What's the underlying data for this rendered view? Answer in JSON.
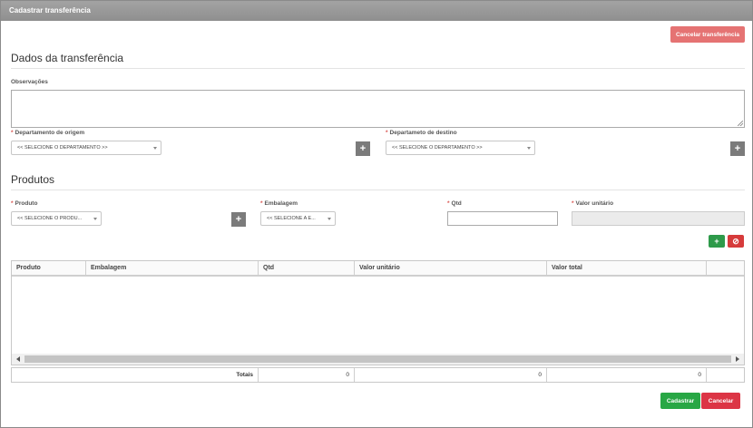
{
  "window": {
    "title": "Cadastrar transferência"
  },
  "actions": {
    "cancel_transfer": "Cancelar transferência"
  },
  "transfer": {
    "section_title": "Dados da transferência",
    "notes_label": "Observações",
    "notes_value": "",
    "origin_label": "Departamento de origem",
    "origin_value": "<< SELECIONE O DEPARTAMENTO >>",
    "destination_label": "Departameto de destino",
    "destination_value": "<< SELECIONE O DEPARTAMENTO >>",
    "required_marker": "*"
  },
  "products": {
    "section_title": "Produtos",
    "product_label": "Produto",
    "product_value": "<< SELECIONE O PRODU...",
    "packaging_label": "Embalagem",
    "packaging_value": "<< SELECIONE A E...",
    "qty_label": "Qtd",
    "qty_value": "",
    "unit_value_label": "Valor unitário",
    "unit_value_value": "",
    "add_icon": "plus-icon",
    "remove_icon": "ban-icon"
  },
  "grid": {
    "columns": [
      "Produto",
      "Embalagem",
      "Qtd",
      "Valor unitário",
      "Valor total"
    ],
    "rows": [],
    "totals_label": "Totais",
    "totals": [
      "0",
      "0",
      "0"
    ]
  },
  "footer": {
    "submit": "Cadastrar",
    "cancel": "Cancelar"
  },
  "colors": {
    "titlebar": "#949494",
    "cancel_transfer": "#e57373",
    "success": "#28a745",
    "danger": "#dc3545",
    "neutral_button": "#7b7b7b"
  }
}
